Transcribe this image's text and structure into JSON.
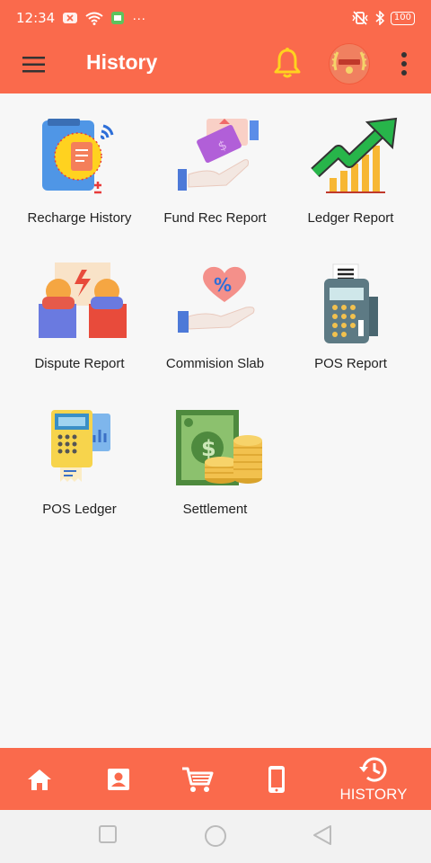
{
  "status_bar": {
    "time": "12:34",
    "more": "···",
    "battery": "100"
  },
  "app_bar": {
    "title": "History"
  },
  "tiles": [
    {
      "label": "Recharge History",
      "icon": "recharge-history-icon"
    },
    {
      "label": "Fund Rec Report",
      "icon": "fund-rec-report-icon"
    },
    {
      "label": "Ledger Report",
      "icon": "ledger-report-icon"
    },
    {
      "label": "Dispute Report",
      "icon": "dispute-report-icon"
    },
    {
      "label": "Commision Slab",
      "icon": "commission-slab-icon"
    },
    {
      "label": "POS Report",
      "icon": "pos-report-icon"
    },
    {
      "label": "POS Ledger",
      "icon": "pos-ledger-icon"
    },
    {
      "label": "Settlement",
      "icon": "settlement-icon"
    }
  ],
  "bottom_nav": {
    "active_label": "HISTORY"
  },
  "colors": {
    "primary": "#fa6a4c",
    "bell": "#ffd21f",
    "background": "#f7f7f7"
  }
}
